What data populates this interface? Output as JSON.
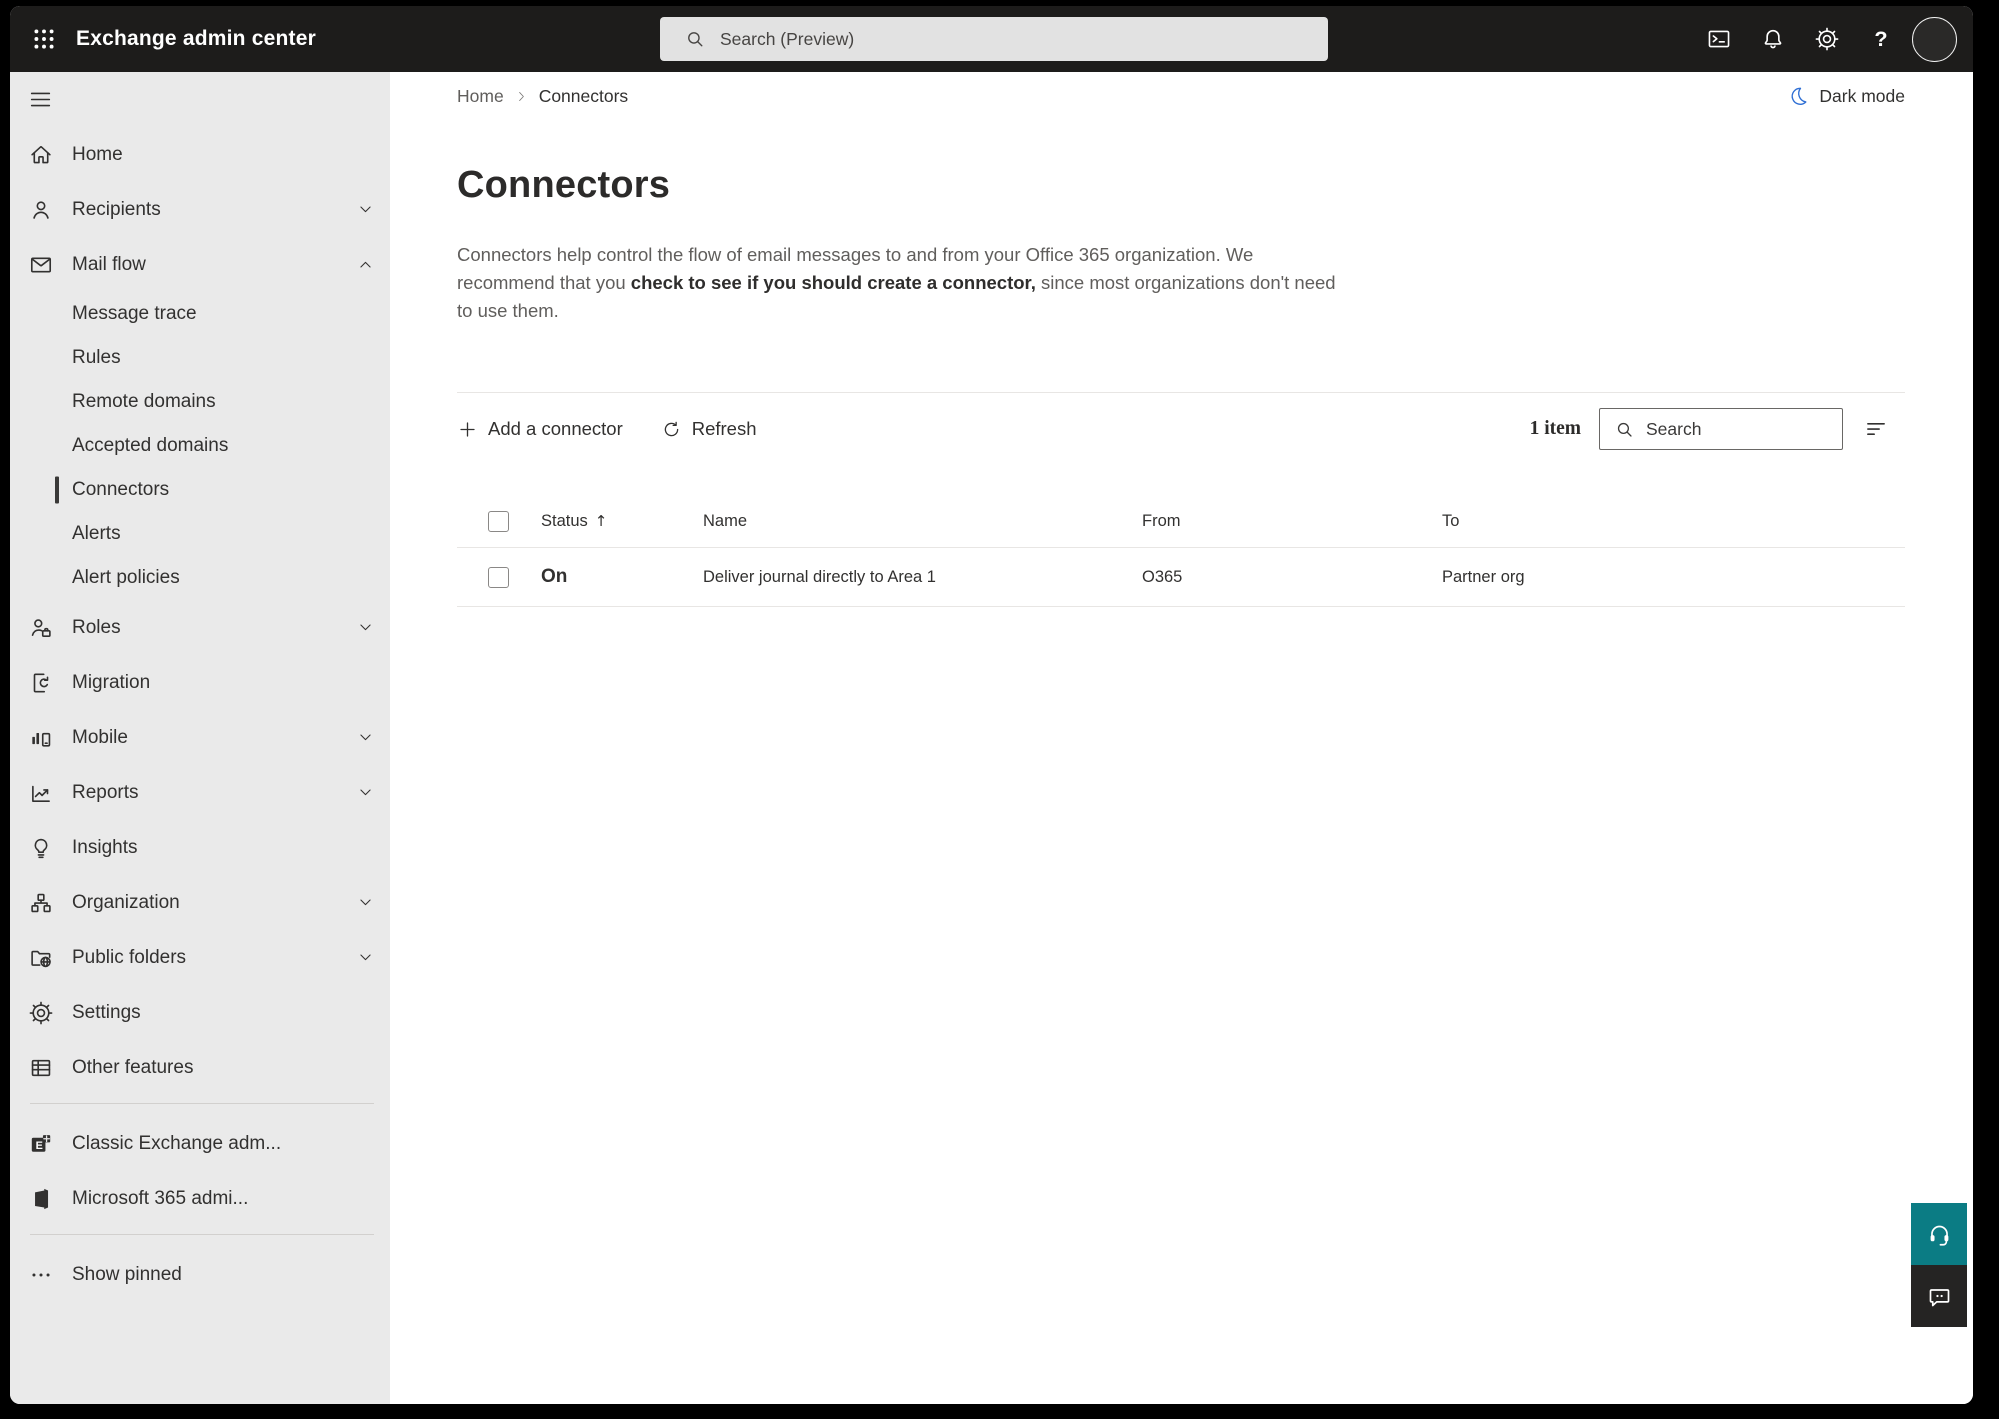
{
  "topbar": {
    "title": "Exchange admin center",
    "search_placeholder": "Search (Preview)",
    "icons": [
      "terminal-icon",
      "bell-icon",
      "gear-icon",
      "help-icon"
    ]
  },
  "sidebar": {
    "items": [
      {
        "label": "Home",
        "icon": "home-icon"
      },
      {
        "label": "Recipients",
        "icon": "person-icon",
        "chevron": "down"
      },
      {
        "label": "Mail flow",
        "icon": "mail-icon",
        "chevron": "up",
        "expanded": true
      },
      {
        "label": "Message trace",
        "sub": true
      },
      {
        "label": "Rules",
        "sub": true
      },
      {
        "label": "Remote domains",
        "sub": true
      },
      {
        "label": "Accepted domains",
        "sub": true
      },
      {
        "label": "Connectors",
        "sub": true,
        "selected": true
      },
      {
        "label": "Alerts",
        "sub": true
      },
      {
        "label": "Alert policies",
        "sub": true
      },
      {
        "label": "Roles",
        "icon": "roles-icon",
        "chevron": "down"
      },
      {
        "label": "Migration",
        "icon": "migration-icon"
      },
      {
        "label": "Mobile",
        "icon": "mobile-icon",
        "chevron": "down"
      },
      {
        "label": "Reports",
        "icon": "reports-icon",
        "chevron": "down"
      },
      {
        "label": "Insights",
        "icon": "insights-icon"
      },
      {
        "label": "Organization",
        "icon": "organization-icon",
        "chevron": "down"
      },
      {
        "label": "Public folders",
        "icon": "public-folders-icon",
        "chevron": "down"
      },
      {
        "label": "Settings",
        "icon": "settings-icon"
      },
      {
        "label": "Other features",
        "icon": "other-features-icon"
      },
      {
        "divider": true
      },
      {
        "label": "Classic Exchange adm...",
        "icon": "exchange-logo-icon"
      },
      {
        "label": "Microsoft 365 admi...",
        "icon": "microsoft365-logo-icon"
      },
      {
        "divider": true
      },
      {
        "label": "Show pinned",
        "icon": "ellipsis-icon"
      }
    ]
  },
  "breadcrumb": {
    "items": [
      "Home",
      "Connectors"
    ]
  },
  "main": {
    "dark_mode_label": "Dark mode",
    "title": "Connectors",
    "description": {
      "pre": "Connectors help control the flow of email messages to and from your Office 365 organization. We recommend that you ",
      "emphasis": "check to see if you should create a connector,",
      "post": " since most organizations don't need to use them."
    }
  },
  "toolbar": {
    "add_label": "Add a connector",
    "refresh_label": "Refresh",
    "item_count": "1 item",
    "search_placeholder": "Search"
  },
  "table": {
    "columns": [
      {
        "label": "Status",
        "sorted": "ascending"
      },
      {
        "label": "Name"
      },
      {
        "label": "From"
      },
      {
        "label": "To"
      }
    ],
    "rows": [
      {
        "status": "On",
        "name": "Deliver journal directly to Area 1",
        "from": "O365",
        "to": "Partner org"
      }
    ]
  },
  "colors": {
    "topbar_bg": "#1d1c1b",
    "sidebar_bg": "#eaeaea",
    "help_teal": "#0b7c84",
    "feedback_dark": "#252423",
    "moon_blue": "#2f6fd4",
    "text_primary": "#323130",
    "text_secondary": "#605e5c"
  }
}
